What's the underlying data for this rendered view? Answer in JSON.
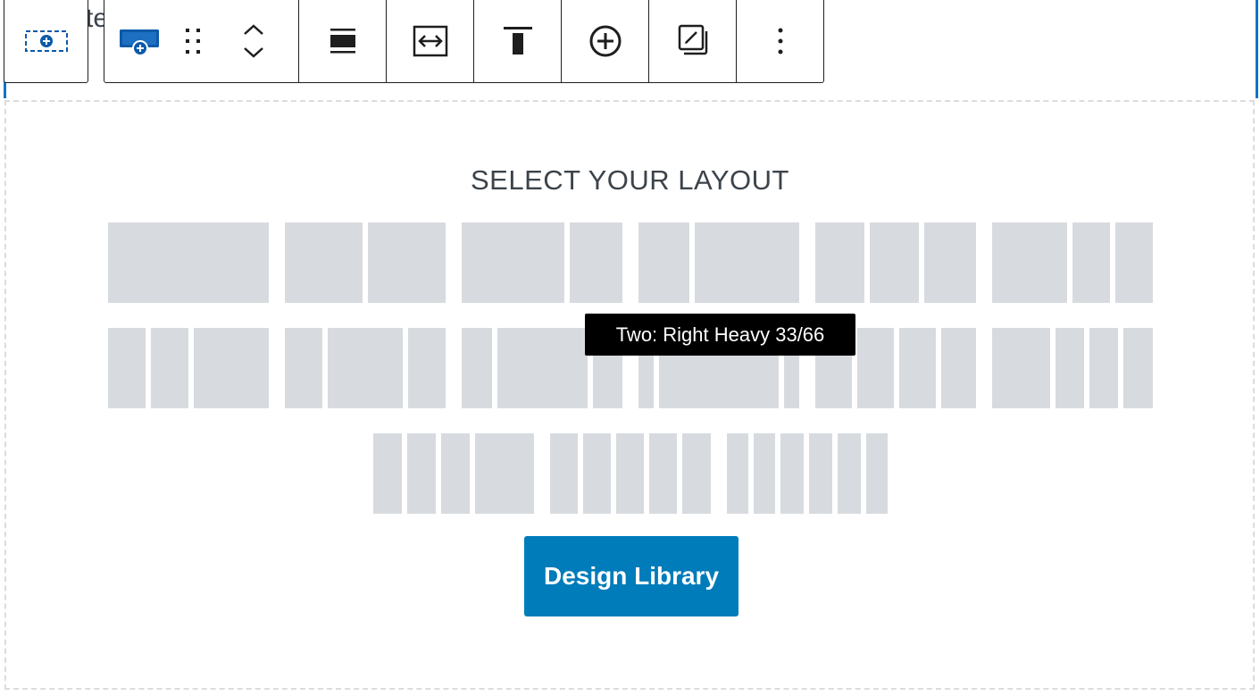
{
  "background_text": "te",
  "toolbar": {
    "parent_block_icon": "row-block-icon",
    "items": [
      {
        "icon": "row-block-icon",
        "type": "block-type"
      },
      {
        "icon": "drag-handle-icon",
        "type": "drag"
      },
      {
        "icon": "move-up-down-icon",
        "type": "mover"
      },
      {
        "icon": "align-wide-icon",
        "type": "align"
      },
      {
        "icon": "full-width-icon",
        "type": "width"
      },
      {
        "icon": "vertical-align-top-icon",
        "type": "valign"
      },
      {
        "icon": "add-circle-icon",
        "type": "add"
      },
      {
        "icon": "edit-style-icon",
        "type": "style"
      },
      {
        "icon": "more-options-icon",
        "type": "more"
      }
    ]
  },
  "colors": {
    "accent": "#0a74c9",
    "button": "#007cba",
    "column_fill": "#d7dbdf",
    "border_dashed": "#dcdcde"
  },
  "placeholder": {
    "title": "SELECT YOUR LAYOUT",
    "layouts": [
      {
        "row": 0,
        "columns": [
          100
        ]
      },
      {
        "row": 0,
        "columns": [
          50,
          50
        ]
      },
      {
        "row": 0,
        "columns": [
          66,
          34
        ]
      },
      {
        "row": 0,
        "columns": [
          33,
          67
        ]
      },
      {
        "row": 0,
        "columns": [
          33,
          33,
          34
        ]
      },
      {
        "row": 0,
        "columns": [
          50,
          25,
          25
        ]
      },
      {
        "row": 1,
        "columns": [
          25,
          25,
          50
        ]
      },
      {
        "row": 1,
        "columns": [
          25,
          50,
          25
        ]
      },
      {
        "row": 1,
        "columns": [
          20,
          60,
          20
        ]
      },
      {
        "row": 1,
        "columns": [
          10,
          80,
          10
        ]
      },
      {
        "row": 1,
        "columns": [
          25,
          25,
          25,
          25
        ]
      },
      {
        "row": 1,
        "columns": [
          40,
          20,
          20,
          20
        ]
      },
      {
        "row": 2,
        "columns": [
          20,
          20,
          20,
          40
        ]
      },
      {
        "row": 2,
        "columns": [
          20,
          20,
          20,
          20,
          20
        ]
      },
      {
        "row": 2,
        "columns": [
          16,
          16,
          17,
          17,
          17,
          17
        ]
      }
    ],
    "tooltip": "Two: Right Heavy 33/66",
    "design_library_label": "Design Library"
  }
}
